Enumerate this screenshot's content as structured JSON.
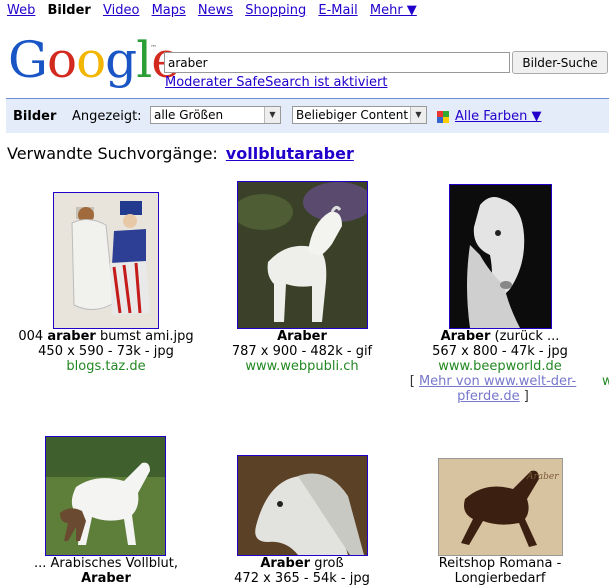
{
  "nav": {
    "web": "Web",
    "bilder": "Bilder",
    "video": "Video",
    "maps": "Maps",
    "news": "News",
    "shopping": "Shopping",
    "email": "E-Mail",
    "mehr": "Mehr ▼"
  },
  "logo": {
    "text": "Google",
    "tm": "™"
  },
  "search": {
    "value": "araber",
    "button": "Bilder-Suche",
    "safesearch": "Moderater SafeSearch ist aktiviert"
  },
  "filterbar": {
    "bilder": "Bilder",
    "angezeigt": "Angezeigt:",
    "size": "alle Größen",
    "content": "Beliebiger Content",
    "colors": "Alle Farben ▼"
  },
  "related": {
    "label": "Verwandte Suchvorgänge:",
    "term": "vollblutaraber"
  },
  "results": [
    {
      "title_pre": "004 ",
      "title_bold": "araber",
      "title_post": " bumst ami.jpg",
      "meta": "450 x 590 - 73k - jpg",
      "site": "blogs.taz.de"
    },
    {
      "title_pre": "",
      "title_bold": "Araber",
      "title_post": "",
      "meta": "787 x 900 - 482k - gif",
      "site": "www.webpubli.ch"
    },
    {
      "title_pre": "",
      "title_bold": "Araber",
      "title_post": " (zurück ...",
      "meta": "567 x 800 - 47k - jpg",
      "site": "www.beepworld.de",
      "more_a": "Mehr von www.welt-der-",
      "more_b": "pferde.de"
    },
    {
      "title_pre": "... Arabisches Vollblut,",
      "title_bold": "Araber",
      "title_post": ""
    },
    {
      "title_pre": "",
      "title_bold": "Araber",
      "title_post": " groß",
      "meta": "472 x 365 - 54k - jpg"
    },
    {
      "title_pre": "Reitshop Romana -",
      "title_bold": "",
      "title_post": "Longierbedarf"
    }
  ],
  "stray": "w"
}
